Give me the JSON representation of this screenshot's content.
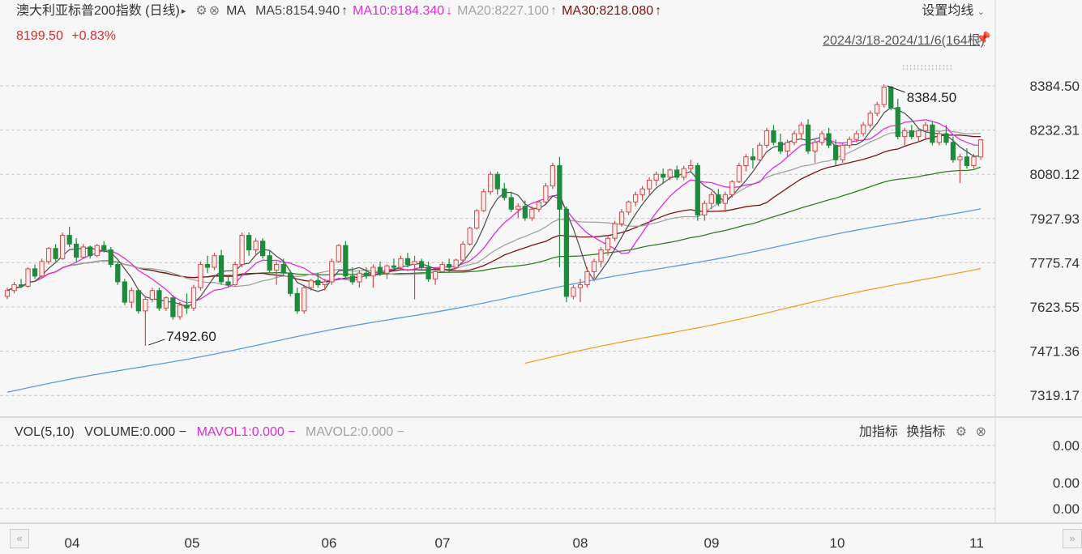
{
  "legend": {
    "title": "澳大利亚标普200指数 (日线)",
    "ma_label": "MA",
    "ma5": "MA5:8154.940",
    "ma5_arrow": "↑",
    "ma10": "MA10:8184.340",
    "ma10_arrow": "↓",
    "ma20": "MA20:8227.100",
    "ma20_arrow": "↑",
    "ma30": "MA30:8218.080",
    "ma30_arrow": "↑",
    "settings_label": "设置均线"
  },
  "price": {
    "last": "8199.50",
    "change": "+0.83%"
  },
  "range": "2024/3/18-2024/11/6(164根)",
  "volume_panel": {
    "vol_label": "VOL(5,10)",
    "volume": "VOLUME:0.000",
    "mavol1": "MAVOL1:0.000",
    "mavol2": "MAVOL2:0.000",
    "add_indicator": "加指标",
    "switch_indicator": "换指标",
    "axis": [
      "0.00",
      "0.00",
      "0.00"
    ]
  },
  "colors": {
    "up": "#d14a4a",
    "down": "#1e8a3c",
    "ma5": "#555555",
    "ma10": "#dd2fd8",
    "ma20": "#a3a3a3",
    "ma30": "#7a1414",
    "ma60": "#2f7d1f",
    "ma120": "#5a9be0",
    "ma250": "#f0a02a",
    "grid": "#c8c8c8"
  },
  "chart_data": {
    "type": "candlestick",
    "y_ticks": [
      "8384.50",
      "8232.31",
      "8080.12",
      "7927.93",
      "7775.74",
      "7623.55",
      "7471.36",
      "7319.17"
    ],
    "ylim": [
      7319.17,
      8384.5
    ],
    "x_ticks": [
      "04",
      "05",
      "06",
      "07",
      "08",
      "09",
      "10",
      "11"
    ],
    "annotations": {
      "high": "8384.50",
      "low": "7492.60"
    },
    "ohlc": [
      [
        7660,
        7690,
        7650,
        7680
      ],
      [
        7680,
        7710,
        7670,
        7700
      ],
      [
        7700,
        7720,
        7690,
        7695
      ],
      [
        7695,
        7760,
        7690,
        7755
      ],
      [
        7755,
        7770,
        7720,
        7730
      ],
      [
        7730,
        7790,
        7725,
        7780
      ],
      [
        7780,
        7830,
        7770,
        7825
      ],
      [
        7825,
        7840,
        7780,
        7790
      ],
      [
        7790,
        7880,
        7785,
        7870
      ],
      [
        7870,
        7900,
        7830,
        7840
      ],
      [
        7840,
        7860,
        7780,
        7795
      ],
      [
        7795,
        7840,
        7790,
        7830
      ],
      [
        7830,
        7835,
        7790,
        7800
      ],
      [
        7800,
        7840,
        7795,
        7835
      ],
      [
        7835,
        7850,
        7810,
        7820
      ],
      [
        7820,
        7830,
        7760,
        7770
      ],
      [
        7770,
        7780,
        7700,
        7710
      ],
      [
        7710,
        7720,
        7630,
        7640
      ],
      [
        7640,
        7690,
        7620,
        7680
      ],
      [
        7680,
        7685,
        7600,
        7610
      ],
      [
        7610,
        7660,
        7490,
        7650
      ],
      [
        7650,
        7690,
        7640,
        7680
      ],
      [
        7680,
        7690,
        7610,
        7620
      ],
      [
        7620,
        7660,
        7610,
        7655
      ],
      [
        7655,
        7665,
        7580,
        7590
      ],
      [
        7590,
        7640,
        7580,
        7630
      ],
      [
        7630,
        7670,
        7600,
        7620
      ],
      [
        7620,
        7700,
        7610,
        7690
      ],
      [
        7690,
        7780,
        7680,
        7770
      ],
      [
        7770,
        7800,
        7740,
        7760
      ],
      [
        7760,
        7810,
        7750,
        7800
      ],
      [
        7800,
        7820,
        7700,
        7710
      ],
      [
        7710,
        7730,
        7690,
        7700
      ],
      [
        7700,
        7780,
        7695,
        7770
      ],
      [
        7770,
        7880,
        7760,
        7870
      ],
      [
        7870,
        7880,
        7800,
        7820
      ],
      [
        7820,
        7860,
        7800,
        7850
      ],
      [
        7850,
        7860,
        7790,
        7800
      ],
      [
        7800,
        7820,
        7740,
        7750
      ],
      [
        7750,
        7780,
        7700,
        7770
      ],
      [
        7770,
        7790,
        7730,
        7740
      ],
      [
        7740,
        7750,
        7660,
        7670
      ],
      [
        7670,
        7690,
        7600,
        7610
      ],
      [
        7610,
        7700,
        7600,
        7690
      ],
      [
        7690,
        7720,
        7680,
        7715
      ],
      [
        7715,
        7740,
        7690,
        7700
      ],
      [
        7700,
        7720,
        7680,
        7710
      ],
      [
        7710,
        7790,
        7700,
        7780
      ],
      [
        7780,
        7840,
        7775,
        7835
      ],
      [
        7835,
        7850,
        7720,
        7730
      ],
      [
        7730,
        7760,
        7700,
        7710
      ],
      [
        7710,
        7750,
        7690,
        7740
      ],
      [
        7740,
        7760,
        7720,
        7730
      ],
      [
        7730,
        7770,
        7690,
        7760
      ],
      [
        7760,
        7780,
        7730,
        7740
      ],
      [
        7740,
        7770,
        7720,
        7765
      ],
      [
        7765,
        7790,
        7750,
        7760
      ],
      [
        7760,
        7800,
        7750,
        7790
      ],
      [
        7790,
        7810,
        7760,
        7770
      ],
      [
        7770,
        7800,
        7650,
        7780
      ],
      [
        7780,
        7790,
        7750,
        7760
      ],
      [
        7760,
        7780,
        7710,
        7720
      ],
      [
        7720,
        7750,
        7700,
        7745
      ],
      [
        7745,
        7780,
        7740,
        7770
      ],
      [
        7770,
        7790,
        7740,
        7760
      ],
      [
        7760,
        7790,
        7755,
        7785
      ],
      [
        7785,
        7850,
        7780,
        7840
      ],
      [
        7840,
        7900,
        7835,
        7895
      ],
      [
        7895,
        7960,
        7890,
        7955
      ],
      [
        7955,
        8030,
        7950,
        8020
      ],
      [
        8020,
        8090,
        8010,
        8080
      ],
      [
        8080,
        8090,
        8010,
        8030
      ],
      [
        8030,
        8050,
        7990,
        8000
      ],
      [
        8000,
        8020,
        7950,
        7960
      ],
      [
        7960,
        7980,
        7930,
        7970
      ],
      [
        7970,
        7990,
        7920,
        7930
      ],
      [
        7930,
        7970,
        7920,
        7960
      ],
      [
        7960,
        7990,
        7950,
        7985
      ],
      [
        7985,
        8050,
        7980,
        8040
      ],
      [
        8040,
        8120,
        8030,
        8110
      ],
      [
        8110,
        8140,
        7760,
        7960
      ],
      [
        7960,
        7970,
        7640,
        7660
      ],
      [
        7660,
        7700,
        7650,
        7690
      ],
      [
        7690,
        7720,
        7640,
        7700
      ],
      [
        7700,
        7760,
        7690,
        7745
      ],
      [
        7745,
        7790,
        7720,
        7780
      ],
      [
        7780,
        7830,
        7760,
        7820
      ],
      [
        7820,
        7870,
        7800,
        7860
      ],
      [
        7860,
        7920,
        7850,
        7910
      ],
      [
        7910,
        7960,
        7900,
        7950
      ],
      [
        7950,
        7990,
        7940,
        7985
      ],
      [
        7985,
        8020,
        7970,
        8010
      ],
      [
        8010,
        8040,
        7990,
        8030
      ],
      [
        8030,
        8070,
        8010,
        8060
      ],
      [
        8060,
        8090,
        8040,
        8080
      ],
      [
        8080,
        8100,
        8050,
        8070
      ],
      [
        8070,
        8100,
        8060,
        8095
      ],
      [
        8095,
        8110,
        8060,
        8070
      ],
      [
        8070,
        8110,
        8060,
        8100
      ],
      [
        8100,
        8130,
        8090,
        8110
      ],
      [
        8110,
        8120,
        7920,
        7940
      ],
      [
        7940,
        7990,
        7920,
        7980
      ],
      [
        7980,
        8020,
        7960,
        8010
      ],
      [
        8010,
        8030,
        7970,
        7980
      ],
      [
        7980,
        8020,
        7950,
        8010
      ],
      [
        8010,
        8060,
        8000,
        8055
      ],
      [
        8055,
        8120,
        8050,
        8110
      ],
      [
        8110,
        8150,
        8090,
        8140
      ],
      [
        8140,
        8170,
        8100,
        8130
      ],
      [
        8130,
        8190,
        8120,
        8180
      ],
      [
        8180,
        8240,
        8170,
        8230
      ],
      [
        8230,
        8250,
        8180,
        8190
      ],
      [
        8190,
        8220,
        8150,
        8160
      ],
      [
        8160,
        8200,
        8140,
        8190
      ],
      [
        8190,
        8230,
        8180,
        8220
      ],
      [
        8220,
        8260,
        8200,
        8250
      ],
      [
        8250,
        8270,
        8150,
        8160
      ],
      [
        8160,
        8200,
        8120,
        8190
      ],
      [
        8190,
        8230,
        8180,
        8220
      ],
      [
        8220,
        8240,
        8170,
        8180
      ],
      [
        8180,
        8200,
        8110,
        8130
      ],
      [
        8130,
        8190,
        8120,
        8180
      ],
      [
        8180,
        8210,
        8170,
        8200
      ],
      [
        8200,
        8230,
        8190,
        8220
      ],
      [
        8220,
        8260,
        8210,
        8250
      ],
      [
        8250,
        8300,
        8240,
        8290
      ],
      [
        8290,
        8330,
        8280,
        8320
      ],
      [
        8320,
        8390,
        8310,
        8380
      ],
      [
        8380,
        8384,
        8300,
        8310
      ],
      [
        8310,
        8340,
        8200,
        8210
      ],
      [
        8210,
        8240,
        8180,
        8230
      ],
      [
        8230,
        8250,
        8200,
        8210
      ],
      [
        8210,
        8240,
        8190,
        8230
      ],
      [
        8230,
        8260,
        8200,
        8250
      ],
      [
        8250,
        8260,
        8180,
        8190
      ],
      [
        8190,
        8230,
        8180,
        8220
      ],
      [
        8220,
        8250,
        8180,
        8190
      ],
      [
        8190,
        8210,
        8120,
        8130
      ],
      [
        8130,
        8150,
        8050,
        8140
      ],
      [
        8140,
        8170,
        8100,
        8110
      ],
      [
        8110,
        8150,
        8100,
        8140
      ],
      [
        8140,
        8200,
        8130,
        8199
      ]
    ]
  }
}
